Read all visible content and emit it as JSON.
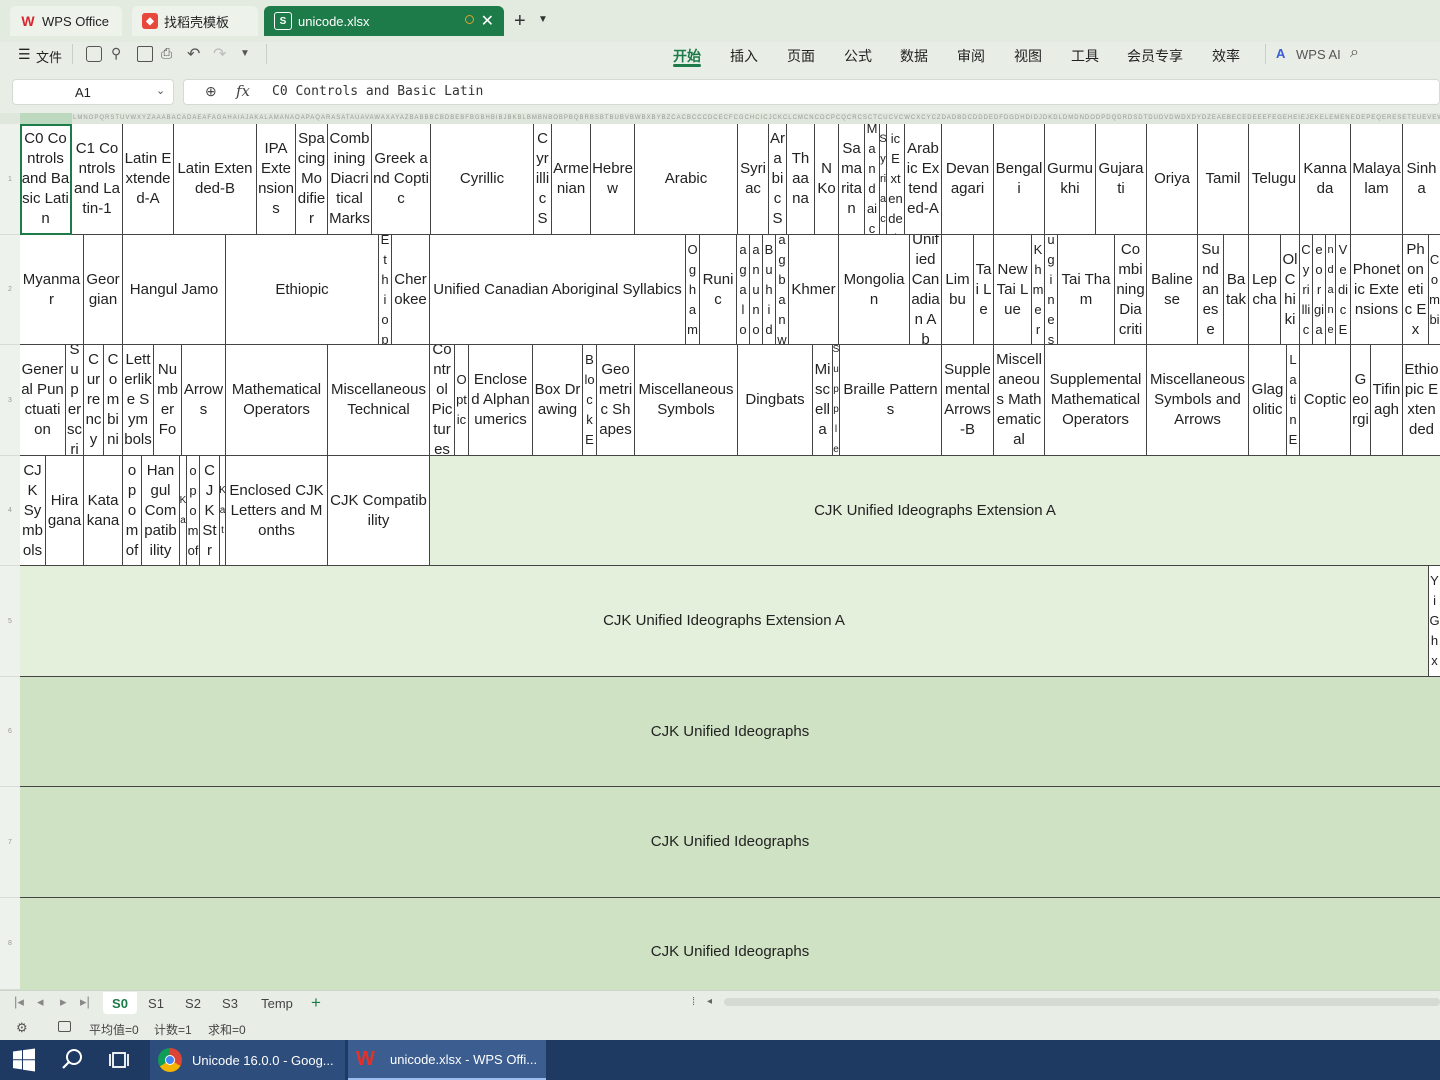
{
  "tabs": [
    {
      "label": "WPS Office",
      "icon": "wps-logo-icon"
    },
    {
      "label": "找稻壳模板",
      "icon": "docer-icon"
    },
    {
      "label": "unicode.xlsx",
      "icon": "spreadsheet-icon"
    }
  ],
  "menu": {
    "file": "文件",
    "items": [
      "开始",
      "插入",
      "页面",
      "公式",
      "数据",
      "审阅",
      "视图",
      "工具",
      "会员专享",
      "效率"
    ],
    "active": "开始",
    "ai": "WPS AI"
  },
  "formula_bar": {
    "cell_ref": "A1",
    "fx": "fx",
    "content": "C0 Controls and Basic Latin"
  },
  "colors": {
    "accent": "#1d7a49",
    "light_green": "#e4efdc",
    "mid_green": "#cfe2c3"
  },
  "row_numbers": [
    "1",
    "2",
    "3",
    "4",
    "5",
    "6",
    "7",
    "8"
  ],
  "cells": {
    "r1": [
      "C0 Controls and Basic Latin",
      "C1 Controls and Latin-1",
      "Latin Extended-A",
      "Latin Extended-B",
      "IPA Extensions",
      "Spacing Modifier",
      "Combining Diacritical Marks",
      "Greek and Coptic",
      "Cyrillic",
      "Cyrillic S",
      "Armenian",
      "Hebrew",
      "Arabic",
      "Syriac",
      "Arabic S",
      "Thaana",
      "N Ko",
      "Samaritan",
      "Mandaic",
      "Syriac",
      "Arabic Extended-B",
      "Arabic Extended-A",
      "Devanagari",
      "Bengali",
      "Gurmukhi",
      "Gujarati",
      "Oriya",
      "Tamil",
      "Telugu",
      "Kannada",
      "Malayalam",
      "Sinha"
    ],
    "r2": [
      "Myanmar",
      "Georgian",
      "Hangul Jamo",
      "Ethiopic",
      "Ethiop",
      "Cherokee",
      "Unified Canadian Aboriginal Syllabics",
      "Ogham",
      "Runic",
      "Tagalog",
      "Hanunoo",
      "Buhid",
      "Tagbanwa",
      "Khmer",
      "Mongolian",
      "Unified Canadian Ab",
      "Limbu",
      "Tai Le",
      "New Tai Lue",
      "Khmer",
      "Buginese",
      "Tai Tham",
      "Combining Diacriti",
      "Balinese",
      "Sundanese",
      "Batak",
      "Lepcha",
      "Ol Chiki",
      "Cyrillic",
      "Georgian",
      "Sundanese",
      "Vedic E",
      "Phonetic Extensions",
      "Phonetic Ex",
      "Combi"
    ],
    "r3": [
      "General Punctuation",
      "Superscri",
      "Currency",
      "Combini",
      "Letterlike Symbols",
      "Number Fo",
      "Arrows",
      "Mathematical Operators",
      "Miscellaneous Technical",
      "Control Pictures",
      "Optic",
      "Enclosed Alphanumerics",
      "Box Drawing",
      "Block E",
      "Geometric Shapes",
      "Miscellaneous Symbols",
      "Dingbats",
      "Miscella",
      "Supple",
      "Braille Patterns",
      "Supplemental Arrows-B",
      "Miscellaneous Mathematical",
      "Supplemental Mathematical Operators",
      "Miscellaneous Symbols and Arrows",
      "Glagolitic",
      "Latin E",
      "Coptic",
      "Georgi",
      "Tifinagh",
      "Ethiopic Extended"
    ],
    "r4": [
      "CJK Symbols",
      "Hiragana",
      "Katakana",
      "Bopomofo",
      "Hangul Compatibility",
      "Ka",
      "Bopomofo",
      "CJK Str",
      "Kat",
      "Enclosed CJK Letters and Months",
      "CJK Compatibility",
      "CJK Unified Ideographs Extension A"
    ],
    "r5": [
      "CJK Unified Ideographs Extension A",
      "Yi Gh x"
    ],
    "r6": [
      "CJK Unified Ideographs"
    ],
    "r7": [
      "CJK Unified Ideographs"
    ],
    "r8": [
      "CJK Unified Ideographs"
    ]
  },
  "sheets": [
    "S0",
    "S1",
    "S2",
    "S3",
    "Temp"
  ],
  "active_sheet": "S0",
  "status": {
    "avg": "平均值=0",
    "count": "计数=1",
    "sum": "求和=0"
  },
  "taskbar": {
    "chrome_title": "Unicode 16.0.0 - Goog...",
    "wps_title": "unicode.xlsx - WPS Offi..."
  }
}
